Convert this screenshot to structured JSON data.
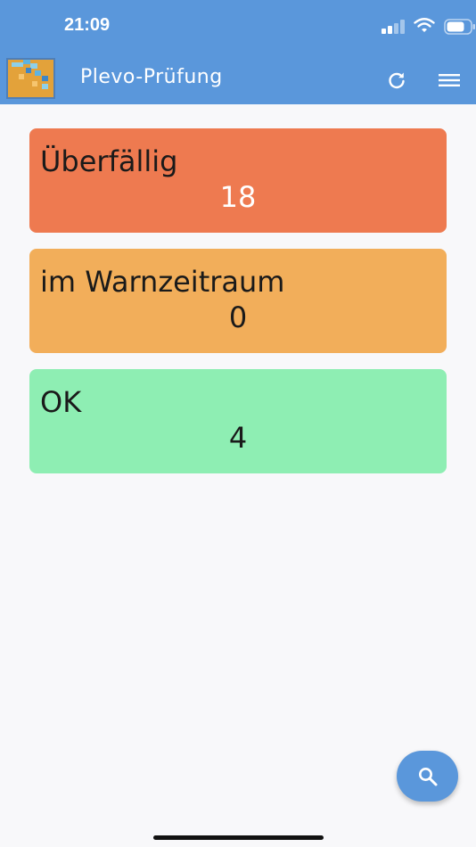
{
  "status_bar": {
    "time": "21:09"
  },
  "app_bar": {
    "title": "Plevo-Prüfung",
    "refresh_icon": "refresh-icon",
    "menu_icon": "hamburger-menu-icon"
  },
  "cards": [
    {
      "label": "Überfällig",
      "count": "18",
      "color": "#ee7a50"
    },
    {
      "label": "im Warnzeitraum",
      "count": "0",
      "color": "#f2ae5a"
    },
    {
      "label": "OK",
      "count": "4",
      "color": "#8eeeb3"
    }
  ],
  "fab": {
    "icon": "search-icon"
  },
  "colors": {
    "app_bar": "#5a97db",
    "background": "#f8f8fa"
  }
}
